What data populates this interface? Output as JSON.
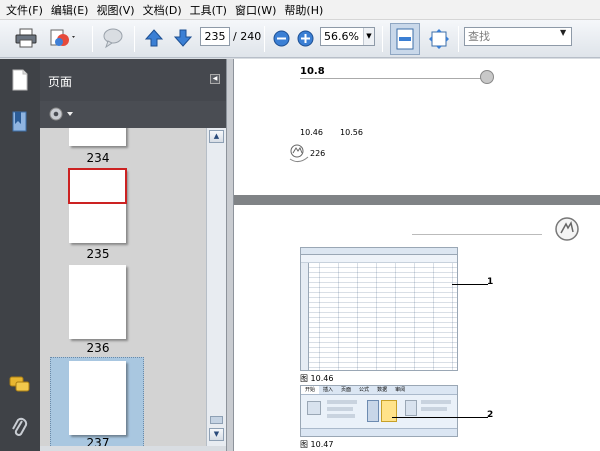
{
  "menu": [
    "文件(F)",
    "编辑(E)",
    "视图(V)",
    "文档(D)",
    "工具(T)",
    "窗口(W)",
    "帮助(H)"
  ],
  "toolbar": {
    "page_current": "235",
    "page_total": "/ 240",
    "zoom": "56.6%",
    "search_placeholder": "查找"
  },
  "panel": {
    "title": "页面",
    "thumbnails": [
      {
        "label": "234",
        "selected": false
      },
      {
        "label": "235",
        "selected": false
      },
      {
        "label": "236",
        "selected": false
      },
      {
        "label": "237",
        "selected": true
      }
    ]
  },
  "document": {
    "top_page": {
      "slider_value": "10.8",
      "item_a": "10.46",
      "item_b": "10.56",
      "note_number": "226"
    },
    "bottom_page": {
      "figure_1_caption": "图 10.46",
      "figure_2_caption": "图 10.47",
      "callout_1": "1",
      "callout_2": "2",
      "ribbon_tabs": [
        "开始",
        "插入",
        "页面",
        "公式",
        "数据",
        "审阅"
      ]
    }
  },
  "colors": {
    "selection_red": "#cc2222",
    "thumb_selected_bg": "#a9c7e0",
    "panel_dark": "#45484e"
  }
}
